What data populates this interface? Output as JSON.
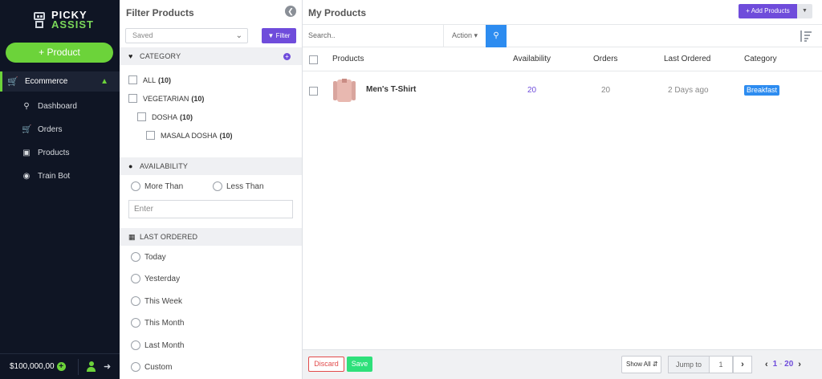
{
  "sidebar": {
    "logo_line1": "PICKY",
    "logo_line2": "ASSIST",
    "add_product_label": "+ Product",
    "section_label": "Ecommerce",
    "items": [
      {
        "label": "Dashboard",
        "icon": "search-icon"
      },
      {
        "label": "Orders",
        "icon": "cart-icon"
      },
      {
        "label": "Products",
        "icon": "briefcase-icon"
      },
      {
        "label": "Train Bot",
        "icon": "android-icon"
      }
    ],
    "balance": "$100,000,00",
    "accent_color": "#6cd33a"
  },
  "filter_panel": {
    "title": "Filter Products",
    "saved_select_value": "Saved",
    "filter_button": "Filter",
    "category": {
      "heading": "CATEGORY",
      "items": [
        {
          "label": "ALL",
          "count": "(10)"
        },
        {
          "label": "VEGETARIAN",
          "count": "(10)"
        },
        {
          "label": "DOSHA",
          "count": "(10)"
        },
        {
          "label": "MASALA DOSHA",
          "count": "(10)"
        }
      ]
    },
    "availability": {
      "heading": "AVAILABILITY",
      "options": [
        "More Than",
        "Less Than"
      ],
      "input_placeholder": "Enter"
    },
    "last_ordered": {
      "heading": "LAST ORDERED",
      "options": [
        "Today",
        "Yesterday",
        "This Week",
        "This Month",
        "Last Month",
        "Custom"
      ]
    }
  },
  "main": {
    "title": "My Products",
    "add_products_button": "Add Products",
    "search_placeholder": "Search..",
    "action_label": "Action",
    "columns": [
      "Products",
      "Availability",
      "Orders",
      "Last Ordered",
      "Category"
    ],
    "rows": [
      {
        "product": "Men's T-Shirt",
        "availability": "20",
        "orders": "20",
        "last_ordered": "2 Days ago",
        "category": "Breakfast"
      }
    ]
  },
  "bottom_bar": {
    "discard_label": "Discard",
    "save_label": "Save",
    "show_all": "Show All",
    "jump_to_label": "Jump to",
    "jump_to_value": "1",
    "range_start": "1",
    "range_end": "20"
  },
  "colors": {
    "primary": "#6f4cdb",
    "info": "#2d8cf0",
    "danger": "#e24b4b",
    "success": "#2ee07a"
  }
}
